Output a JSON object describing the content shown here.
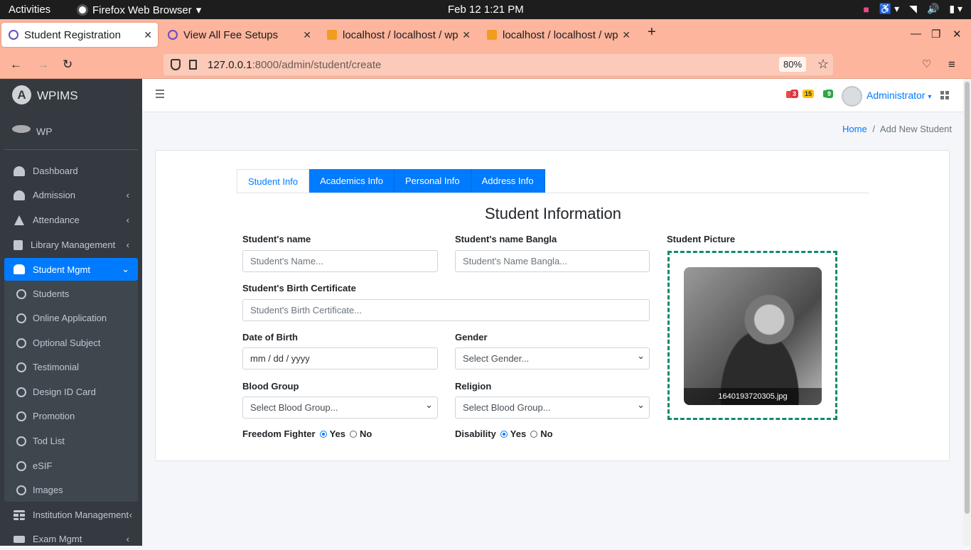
{
  "system_bar": {
    "activities": "Activities",
    "app_name": "Firefox Web Browser",
    "clock": "Feb 12  1:21 PM"
  },
  "browser": {
    "tabs": [
      {
        "label": "Student Registration",
        "active": true
      },
      {
        "label": "View All Fee Setups",
        "active": false
      },
      {
        "label": "localhost / localhost / wp",
        "active": false
      },
      {
        "label": "localhost / localhost / wp",
        "active": false
      }
    ],
    "new_tab": "+",
    "url_host": "127.0.0.1",
    "url_rest": ":8000/admin/student/create",
    "zoom": "80%"
  },
  "sidebar": {
    "brand_logo": "A",
    "brand": "WPIMS",
    "user": "WP",
    "items": [
      {
        "label": "Dashboard",
        "icon": "dashboard-icon"
      },
      {
        "label": "Admission",
        "icon": "user-plus-icon",
        "has_arrow": true
      },
      {
        "label": "Attendance",
        "icon": "tree-icon",
        "has_arrow": true
      },
      {
        "label": "Library Management",
        "icon": "book-icon",
        "has_arrow": true
      },
      {
        "label": "Student Mgmt",
        "icon": "graduate-icon",
        "active": true
      },
      {
        "label": "Students",
        "icon": "circle-icon"
      },
      {
        "label": "Online Application",
        "icon": "circle-icon"
      },
      {
        "label": "Optional Subject",
        "icon": "circle-icon"
      },
      {
        "label": "Testimonial",
        "icon": "circle-icon"
      },
      {
        "label": "Design ID Card",
        "icon": "circle-icon"
      },
      {
        "label": "Promotion",
        "icon": "circle-icon"
      },
      {
        "label": "Tod List",
        "icon": "circle-icon"
      },
      {
        "label": "eSIF",
        "icon": "circle-icon"
      },
      {
        "label": "Images",
        "icon": "circle-icon"
      },
      {
        "label": "Institution Management",
        "icon": "table-icon",
        "has_arrow": true
      },
      {
        "label": "Exam Mgmt",
        "icon": "sitemap-icon",
        "has_arrow": true
      }
    ]
  },
  "header": {
    "badges": [
      "3",
      "15",
      "9"
    ],
    "user": "Administrator"
  },
  "breadcrumb": {
    "home": "Home",
    "separator": "/",
    "current": "Add New Student"
  },
  "form": {
    "tabs": [
      "Student Info",
      "Academics Info",
      "Personal Info",
      "Address Info"
    ],
    "title": "Student Information",
    "name_label": "Student's name",
    "name_placeholder": "Student's  Name...",
    "name_bn_label": "Student's name Bangla",
    "name_bn_placeholder": "Student's  Name Bangla...",
    "birth_cert_label": "Student's Birth Certificate",
    "birth_cert_placeholder": "Student's  Birth Certificate...",
    "dob_label": "Date of Birth",
    "dob_value": "mm / dd / yyyy",
    "gender_label": "Gender",
    "gender_value": "Select Gender...",
    "blood_label": "Blood Group",
    "blood_value": "Select Blood Group...",
    "religion_label": "Religion",
    "religion_value": "Select Blood Group...",
    "freedom_label": "Freedom Fighter",
    "disability_label": "Disability",
    "yes": "Yes",
    "no": "No",
    "picture_label": "Student Picture",
    "picture_filename": "1640193720305.jpg"
  }
}
